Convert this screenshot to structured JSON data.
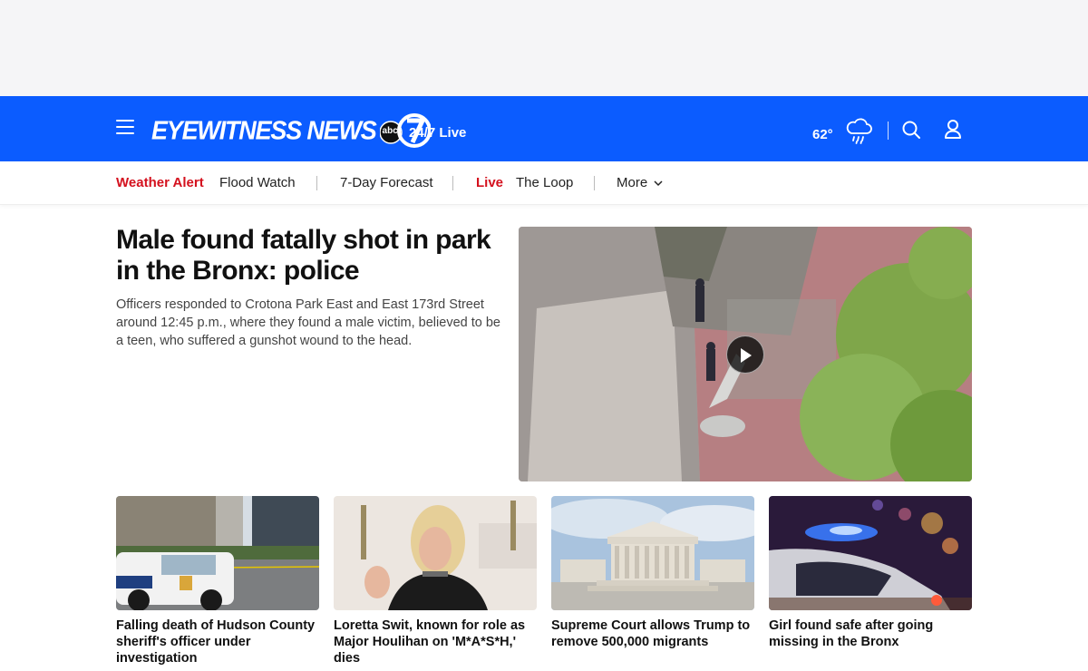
{
  "header": {
    "brand": "EYEWITNESS NEWS",
    "logo_badge": "abc",
    "logo_number": "7",
    "live_label": "24/7 Live",
    "temperature": "62°",
    "weather_icon": "rain-cloud-icon",
    "brand_color": "#0b5cff"
  },
  "subnav": {
    "alert_tag": "Weather Alert",
    "alert_link": "Flood Watch",
    "forecast_link": "7-Day Forecast",
    "live_tag": "Live",
    "loop_link": "The Loop",
    "more_label": "More",
    "accent_color": "#d4111e"
  },
  "hero": {
    "title": "Male found fatally shot in park in the Bronx: police",
    "description": "Officers responded to Crotona Park East and East 173rd Street around 12:45 p.m., where they found a male victim, believed to be a teen, who suffered a gunshot wound to the head.",
    "media_icon": "play-icon"
  },
  "cards": [
    {
      "headline": "Falling death of Hudson County sheriff's officer under investigation"
    },
    {
      "headline": "Loretta Swit, known for role as Major Houlihan on 'M*A*S*H,' dies"
    },
    {
      "headline": "Supreme Court allows Trump to remove 500,000 migrants"
    },
    {
      "headline": "Girl found safe after going missing in the Bronx"
    }
  ]
}
